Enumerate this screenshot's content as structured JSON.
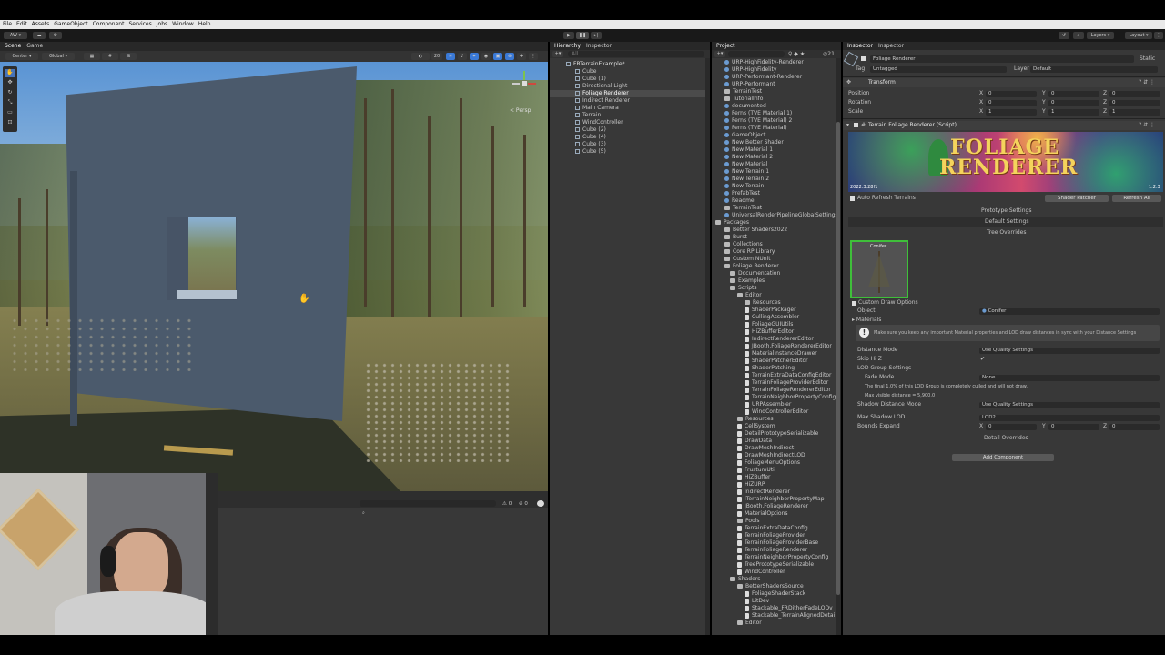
{
  "menu": [
    "File",
    "Edit",
    "Assets",
    "GameObject",
    "Component",
    "Services",
    "Jobs",
    "Window",
    "Help"
  ],
  "toolbar": {
    "account": "AW",
    "layers": "Layers",
    "layout": "Layout"
  },
  "scene": {
    "tabs": [
      "Scene",
      "Game"
    ],
    "pivot": "Center",
    "space": "Global",
    "persp": "< Persp",
    "grid_size": "20",
    "badge_counts": [
      "0",
      "0"
    ]
  },
  "hierarchy": {
    "tabs": [
      "Hierarchy",
      "Inspector"
    ],
    "search_placeholder": "All",
    "scene_name": "FRTerrainExample*",
    "items": [
      "Cube",
      "Cube (1)",
      "Directional Light",
      "Foliage Renderer",
      "Indirect Renderer",
      "Main Camera",
      "Terrain",
      "WindController",
      "Cube (2)",
      "Cube (4)",
      "Cube (3)",
      "Cube (5)"
    ],
    "selected_index": 3
  },
  "project": {
    "tab": "Project",
    "count": "21",
    "assets": [
      "URP-HighFidelity-Renderer",
      "URP-HighFidelity",
      "URP-Performant-Renderer",
      "URP-Performant",
      "TerrainTest",
      "TutorialInfo",
      "documented",
      "Ferns (TVE Material 1)",
      "Ferns (TVE Material) 2",
      "Ferns (TVE Material)",
      "GameObject",
      "New Better Shader",
      "New Material 1",
      "New Material 2",
      "New Material",
      "New Terrain 1",
      "New Terrain 2",
      "New Terrain",
      "PrefabTest",
      "Readme",
      "TerrainTest",
      "UniversalRenderPipelineGlobalSettings"
    ],
    "packages_label": "Packages",
    "packages": [
      "Better Shaders2022",
      "Burst",
      "Collections",
      "Core RP Library",
      "Custom NUnit",
      "Foliage Renderer",
      "Documentation",
      "Examples",
      "Scripts",
      "Editor",
      "Resources",
      "ShaderPackager",
      "CullingAssembler",
      "FoliageGUIUtils",
      "HiZBufferEditor",
      "IndirectRendererEditor",
      "JBooth.FoliageRendererEditor",
      "MaterialInstanceDrawer",
      "ShaderPatcherEditor",
      "ShaderPatching",
      "TerrainExtraDataConfigEditor",
      "TerrainFoliageProviderEditor",
      "TerrainFoliageRendererEditor",
      "TerrainNeighborPropertyConfig",
      "URPAssembler",
      "WindControllerEditor",
      "Resources",
      "CellSystem",
      "DetailPrototypeSerializable",
      "DrawData",
      "DrawMeshIndirect",
      "DrawMeshIndirectLOD",
      "FoliageMenuOptions",
      "FrustumUtil",
      "HiZBuffer",
      "HiZURP",
      "IndirectRenderer",
      "ITerrainNeighborPropertyMap",
      "JBooth.FoliageRenderer",
      "MaterialOptions",
      "Pools",
      "TerrainExtraDataConfig",
      "TerrainFoliageProvider",
      "TerrainFoliageProviderBase",
      "TerrainFoliageRenderer",
      "TerrainNeighborPropertyConfig",
      "TreePrototypeSerializable",
      "WindController",
      "Shaders",
      "BetterShadersSource",
      "FoliageShaderStack",
      "LitDev",
      "Stackable_FRDitherFadeLODv",
      "Stackable_TerrainAlignedDetai",
      "Editor"
    ]
  },
  "inspector": {
    "tabs": [
      "Inspector",
      "Inspector"
    ],
    "object_name": "Foliage Renderer",
    "static_label": "Static",
    "tag_label": "Tag",
    "tag_value": "Untagged",
    "layer_label": "Layer",
    "layer_value": "Default",
    "transform_title": "Transform",
    "transform_rows": [
      {
        "label": "Position",
        "x": "0",
        "y": "0",
        "z": "0"
      },
      {
        "label": "Rotation",
        "x": "0",
        "y": "0",
        "z": "0"
      },
      {
        "label": "Scale",
        "x": "1",
        "y": "1",
        "z": "1"
      }
    ],
    "component_title": "Terrain Foliage Renderer (Script)",
    "banner_title_1": "FOLIAGE",
    "banner_title_2": "RENDERER",
    "banner_version": "2022.3.28f1",
    "banner_version_right": "1.2.3",
    "auto_refresh": "Auto Refresh Terrains",
    "shader_patcher": "Shader Patcher",
    "refresh_all": "Refresh All",
    "prototype_settings": "Prototype Settings",
    "default_settings": "Default Settings",
    "tree_overrides": "Tree Overrides",
    "thumb_label": "Conifer",
    "custom_draw": "Custom Draw Options",
    "object_label": "Object",
    "object_value": "Conifer",
    "materials_label": "Materials",
    "warning": "Make sure you keep any important Material properties and LOD draw distances in sync with your Distance Settings",
    "distance_mode_label": "Distance Mode",
    "distance_mode_value": "Use Quality Settings",
    "skip_hiz_label": "Skip Hi Z",
    "lod_group_label": "LOD Group Settings",
    "fade_mode_label": "Fade Mode",
    "fade_mode_value": "None",
    "lod_note_1": "The final 1.0% of this LOD Group is completely culled and will not draw.",
    "lod_note_2": "Max visible distance = 5,900.0",
    "shadow_distance_label": "Shadow Distance Mode",
    "shadow_distance_value": "Use Quality Settings",
    "max_shadow_label": "Max Shadow LOD",
    "max_shadow_value": "LOD2",
    "bounds_label": "Bounds Expand",
    "bounds": {
      "x": "0",
      "y": "0",
      "z": "0"
    },
    "detail_overrides": "Detail Overrides",
    "add_component": "Add Component"
  },
  "colors": {
    "accent": "#3a79d6",
    "selected": "#3e5f96",
    "highlight": "#2c5d87"
  }
}
